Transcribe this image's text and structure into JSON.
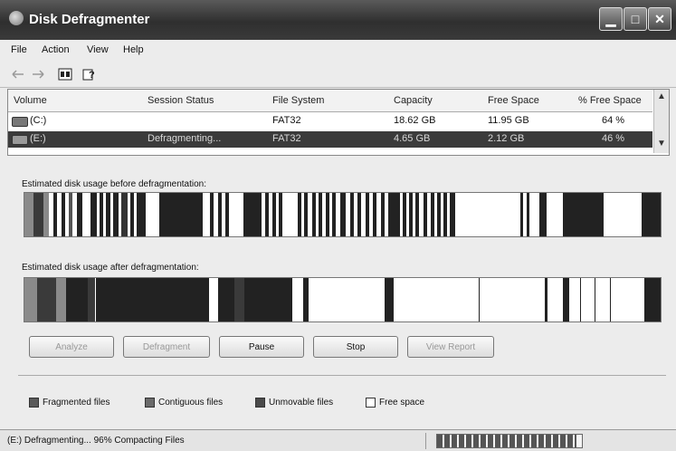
{
  "window": {
    "title": "Disk Defragmenter"
  },
  "menu": [
    "File",
    "Action",
    "View",
    "Help"
  ],
  "toolbar": {
    "icons": [
      "back-arrow-icon",
      "forward-arrow-icon",
      "properties-icon",
      "help-icon"
    ]
  },
  "volumes": {
    "headers": [
      "Volume",
      "Session Status",
      "File System",
      "Capacity",
      "Free Space",
      "% Free Space"
    ],
    "rows": [
      {
        "volume": "(C:)",
        "status": "",
        "fs": "FAT32",
        "capacity": "18.62 GB",
        "free": "11.95 GB",
        "pct": "64 %",
        "selected": false
      },
      {
        "volume": "(E:)",
        "status": "Defragmenting...",
        "fs": "FAT32",
        "capacity": "4.65 GB",
        "free": "2.12 GB",
        "pct": "46 %",
        "selected": true
      }
    ]
  },
  "analysis": {
    "before_label": "Estimated disk usage before defragmentation:",
    "after_label": "Estimated disk usage after defragmentation:",
    "before_segments": [
      [
        0.0,
        0.014,
        "#8a8a8a"
      ],
      [
        0.014,
        0.03,
        "#3a3a3a"
      ],
      [
        0.03,
        0.038,
        "#8a8a8a"
      ],
      [
        0.046,
        0.052,
        "#222"
      ],
      [
        0.058,
        0.064,
        "#222"
      ],
      [
        0.07,
        0.076,
        "#555"
      ],
      [
        0.082,
        0.09,
        "#222"
      ],
      [
        0.104,
        0.114,
        "#222"
      ],
      [
        0.118,
        0.124,
        "#222"
      ],
      [
        0.128,
        0.135,
        "#222"
      ],
      [
        0.14,
        0.148,
        "#222"
      ],
      [
        0.152,
        0.162,
        "#333"
      ],
      [
        0.166,
        0.172,
        "#222"
      ],
      [
        0.176,
        0.19,
        "#222"
      ],
      [
        0.212,
        0.28,
        "#222"
      ],
      [
        0.292,
        0.298,
        "#222"
      ],
      [
        0.304,
        0.31,
        "#222"
      ],
      [
        0.316,
        0.322,
        "#222"
      ],
      [
        0.344,
        0.372,
        "#222"
      ],
      [
        0.378,
        0.384,
        "#222"
      ],
      [
        0.39,
        0.396,
        "#222"
      ],
      [
        0.4,
        0.406,
        "#222"
      ],
      [
        0.43,
        0.436,
        "#222"
      ],
      [
        0.44,
        0.446,
        "#222"
      ],
      [
        0.452,
        0.458,
        "#222"
      ],
      [
        0.462,
        0.468,
        "#222"
      ],
      [
        0.474,
        0.48,
        "#222"
      ],
      [
        0.484,
        0.49,
        "#222"
      ],
      [
        0.496,
        0.504,
        "#222"
      ],
      [
        0.512,
        0.518,
        "#222"
      ],
      [
        0.524,
        0.53,
        "#222"
      ],
      [
        0.536,
        0.542,
        "#222"
      ],
      [
        0.548,
        0.554,
        "#222"
      ],
      [
        0.56,
        0.566,
        "#222"
      ],
      [
        0.572,
        0.59,
        "#222"
      ],
      [
        0.594,
        0.6,
        "#222"
      ],
      [
        0.604,
        0.61,
        "#222"
      ],
      [
        0.614,
        0.62,
        "#222"
      ],
      [
        0.628,
        0.634,
        "#222"
      ],
      [
        0.638,
        0.644,
        "#222"
      ],
      [
        0.648,
        0.654,
        "#222"
      ],
      [
        0.658,
        0.664,
        "#222"
      ],
      [
        0.668,
        0.676,
        "#222"
      ],
      [
        0.78,
        0.784,
        "#222"
      ],
      [
        0.79,
        0.794,
        "#222"
      ],
      [
        0.81,
        0.822,
        "#222"
      ],
      [
        0.846,
        0.91,
        "#222"
      ],
      [
        0.97,
        1.0,
        "#222"
      ]
    ],
    "after_segments": [
      [
        0.0,
        0.02,
        "#8a8a8a"
      ],
      [
        0.02,
        0.05,
        "#3a3a3a"
      ],
      [
        0.05,
        0.066,
        "#8a8a8a"
      ],
      [
        0.066,
        0.1,
        "#222"
      ],
      [
        0.1,
        0.112,
        "#3a3a3a"
      ],
      [
        0.112,
        0.29,
        "#222"
      ],
      [
        0.305,
        0.33,
        "#222"
      ],
      [
        0.33,
        0.345,
        "#3a3a3a"
      ],
      [
        0.345,
        0.42,
        "#222"
      ],
      [
        0.438,
        0.446,
        "#222"
      ],
      [
        0.566,
        0.58,
        "#222"
      ],
      [
        0.714,
        0.716,
        "#222"
      ],
      [
        0.818,
        0.822,
        "#222"
      ],
      [
        0.846,
        0.856,
        "#222"
      ],
      [
        0.874,
        0.876,
        "#222"
      ],
      [
        0.896,
        0.898,
        "#222"
      ],
      [
        0.92,
        0.922,
        "#222"
      ],
      [
        0.974,
        1.0,
        "#222"
      ]
    ]
  },
  "buttons": [
    {
      "label": "Analyze",
      "enabled": false
    },
    {
      "label": "Defragment",
      "enabled": false
    },
    {
      "label": "Pause",
      "enabled": true
    },
    {
      "label": "Stop",
      "enabled": true
    },
    {
      "label": "View Report",
      "enabled": false
    }
  ],
  "legend": [
    {
      "label": "Fragmented files",
      "color": "#5a5a5a"
    },
    {
      "label": "Contiguous files",
      "color": "#6a6a6a"
    },
    {
      "label": "Unmovable files",
      "color": "#4a4a4a"
    },
    {
      "label": "Free space",
      "color": "#ffffff"
    }
  ],
  "status": {
    "text": "(E:) Defragmenting...  96%  Compacting Files",
    "progress": 0.96
  }
}
